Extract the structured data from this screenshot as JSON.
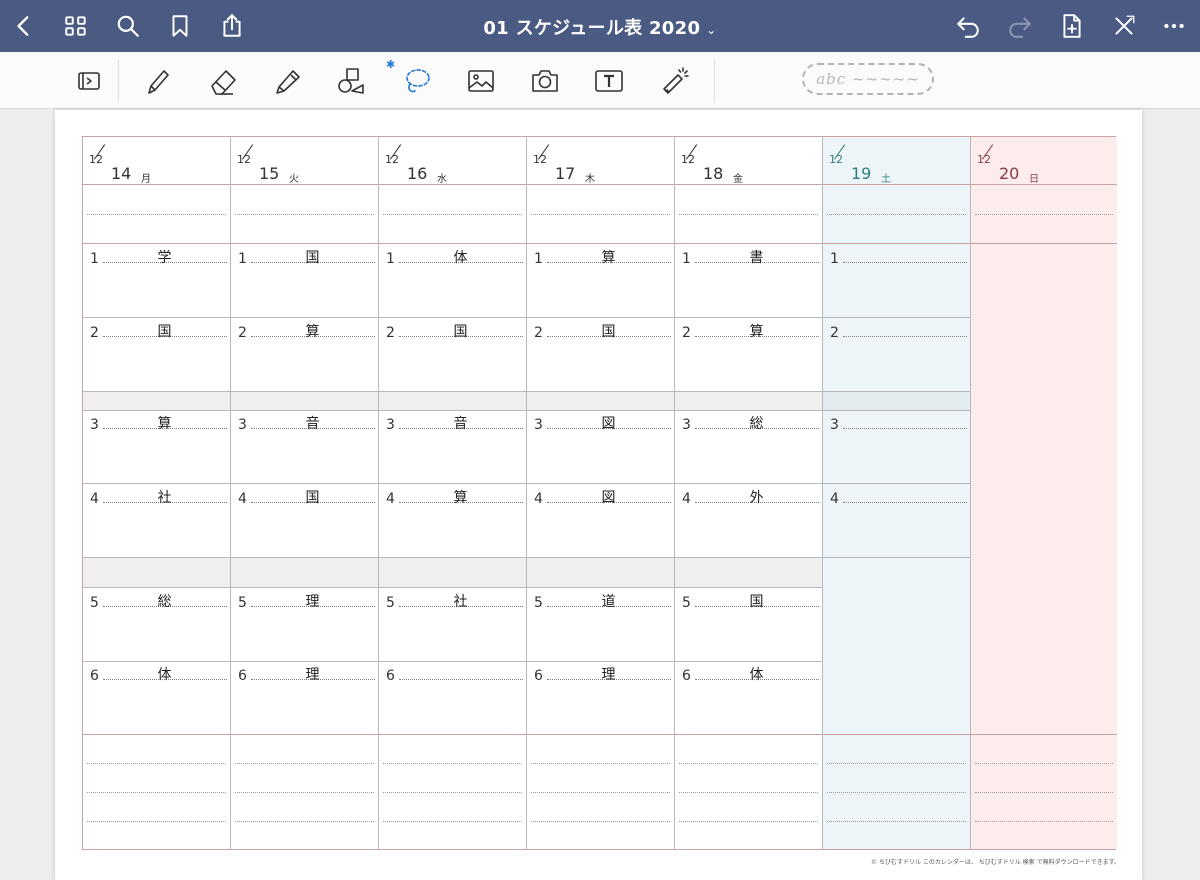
{
  "app": {
    "title": "01 スケジュール表 2020",
    "title_chevron": "⌄",
    "accent": "#4a5a82"
  },
  "topbar_icons": [
    "back-icon",
    "grid-icon",
    "search-icon",
    "bookmark-icon",
    "share-icon",
    "undo-icon",
    "redo-icon",
    "add-page-icon",
    "close-icon",
    "more-icon"
  ],
  "tools": [
    "sidebar-icon",
    "pen-icon",
    "eraser-icon",
    "highlighter-icon",
    "shapes-icon",
    "lasso-icon",
    "image-icon",
    "camera-icon",
    "textbox-icon",
    "laser-pointer-icon"
  ],
  "toolbar": {
    "bluetooth": "✱",
    "handwriting_sample": "abc ~~~~~"
  },
  "calendar": {
    "days": [
      {
        "month": "12",
        "day": "14",
        "weekday": "月",
        "color": "#333333",
        "bg": "#ffffff"
      },
      {
        "month": "12",
        "day": "15",
        "weekday": "火",
        "color": "#333333",
        "bg": "#ffffff"
      },
      {
        "month": "12",
        "day": "16",
        "weekday": "水",
        "color": "#333333",
        "bg": "#ffffff"
      },
      {
        "month": "12",
        "day": "17",
        "weekday": "木",
        "color": "#333333",
        "bg": "#ffffff"
      },
      {
        "month": "12",
        "day": "18",
        "weekday": "金",
        "color": "#333333",
        "bg": "#ffffff"
      },
      {
        "month": "12",
        "day": "19",
        "weekday": "土",
        "color": "#2e7d7d",
        "bg": "#eef5f8"
      },
      {
        "month": "12",
        "day": "20",
        "weekday": "日",
        "color": "#8a3b46",
        "bg": "#fcecec"
      }
    ],
    "periods": [
      "1",
      "2",
      "3",
      "4",
      "5",
      "6"
    ],
    "saturday_periods": [
      "1",
      "2",
      "3",
      "4"
    ],
    "subjects": [
      [
        "学",
        "国",
        "算",
        "社",
        "総",
        "体"
      ],
      [
        "国",
        "算",
        "音",
        "国",
        "理",
        "理"
      ],
      [
        "体",
        "国",
        "音",
        "算",
        "社",
        ""
      ],
      [
        "算",
        "国",
        "図",
        "図",
        "道",
        "理"
      ],
      [
        "書",
        "算",
        "総",
        "外",
        "国",
        "体"
      ]
    ]
  },
  "footer": {
    "credit": "© ちびむすドリル  このカレンダーは、 ちびむすドリル 検索 で無料ダウンロードできます。"
  }
}
